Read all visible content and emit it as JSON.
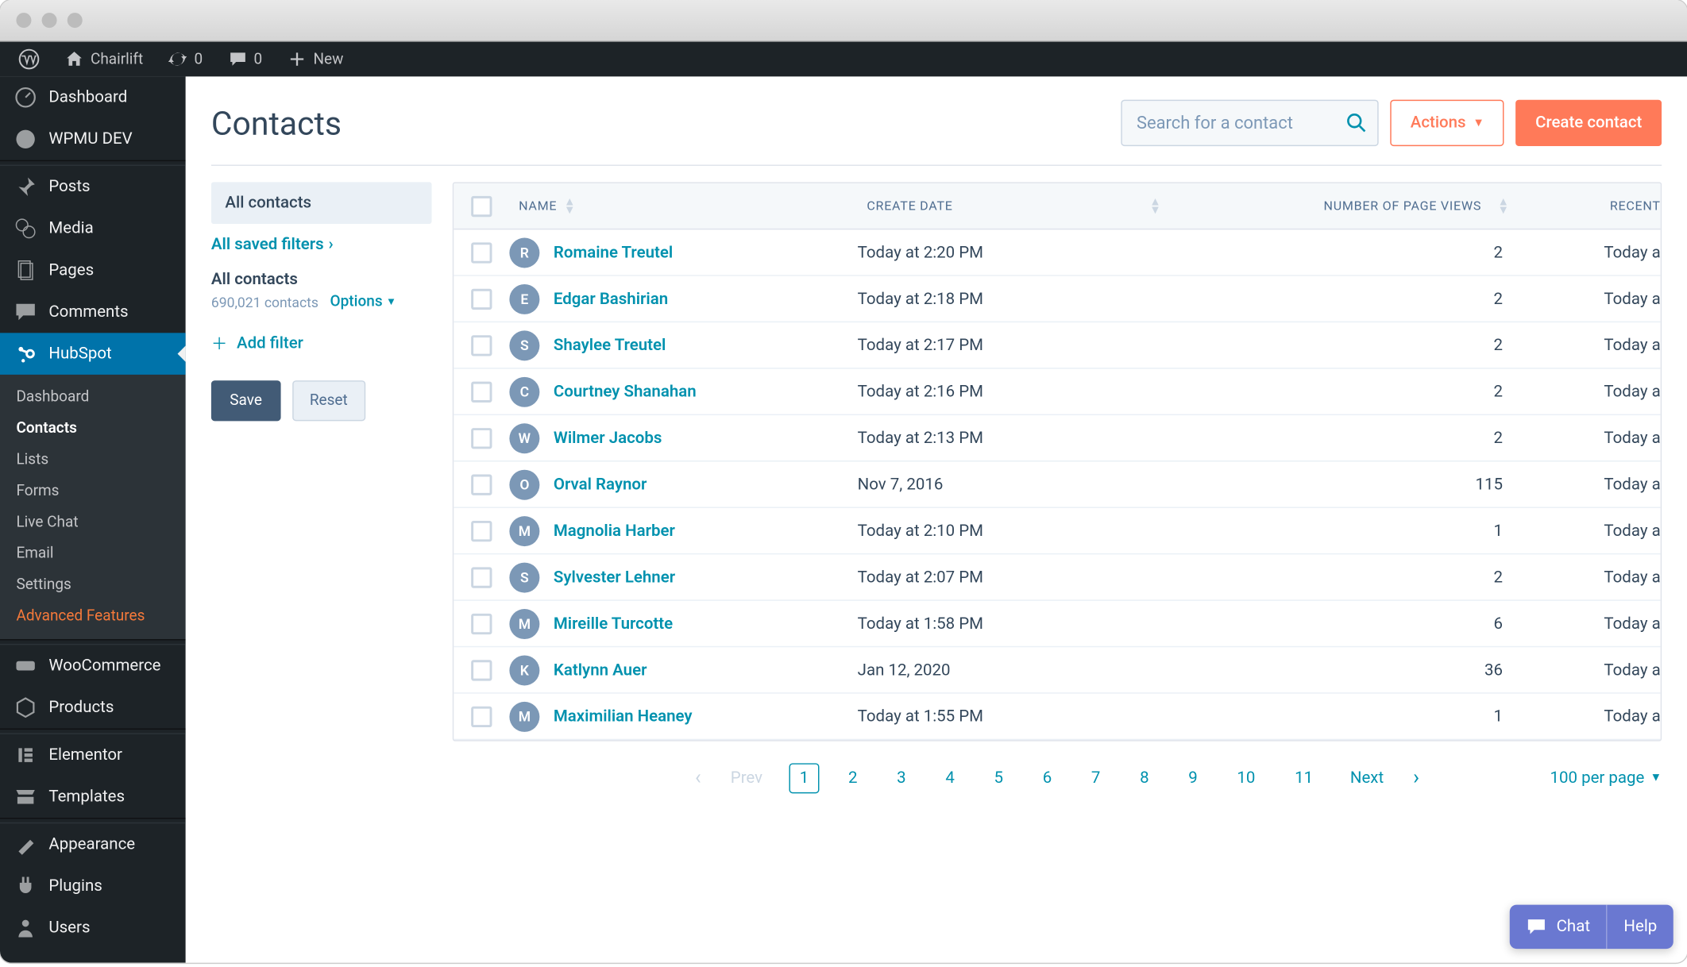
{
  "adminbar": {
    "site_name": "Chairlift",
    "updates_count": "0",
    "comments_count": "0",
    "new_label": "New"
  },
  "wp_menu": {
    "items": [
      {
        "label": "Dashboard",
        "icon": "dashboard"
      },
      {
        "label": "WPMU DEV",
        "icon": "wpmu"
      },
      {
        "label": "Posts",
        "icon": "pin"
      },
      {
        "label": "Media",
        "icon": "media"
      },
      {
        "label": "Pages",
        "icon": "pages"
      },
      {
        "label": "Comments",
        "icon": "comment"
      },
      {
        "label": "HubSpot",
        "icon": "hubspot",
        "active": true
      },
      {
        "label": "WooCommerce",
        "icon": "woo"
      },
      {
        "label": "Products",
        "icon": "products"
      },
      {
        "label": "Elementor",
        "icon": "elementor"
      },
      {
        "label": "Templates",
        "icon": "templates"
      },
      {
        "label": "Appearance",
        "icon": "appearance"
      },
      {
        "label": "Plugins",
        "icon": "plugins"
      },
      {
        "label": "Users",
        "icon": "users"
      }
    ],
    "submenu": [
      {
        "label": "Dashboard"
      },
      {
        "label": "Contacts",
        "current": true
      },
      {
        "label": "Lists"
      },
      {
        "label": "Forms"
      },
      {
        "label": "Live Chat"
      },
      {
        "label": "Email"
      },
      {
        "label": "Settings"
      },
      {
        "label": "Advanced Features",
        "orange": true
      }
    ]
  },
  "page": {
    "title": "Contacts"
  },
  "search": {
    "placeholder": "Search for a contact"
  },
  "buttons": {
    "actions": "Actions",
    "create": "Create contact",
    "save": "Save",
    "reset": "Reset",
    "add_filter": "Add filter"
  },
  "filters": {
    "tab": "All contacts",
    "saved": "All saved filters",
    "heading": "All contacts",
    "count": "690,021 contacts",
    "options": "Options"
  },
  "table": {
    "headers": {
      "name": "NAME",
      "create_date": "CREATE DATE",
      "page_views": "NUMBER OF PAGE VIEWS",
      "recent": "RECENT"
    },
    "rows": [
      {
        "initial": "R",
        "name": "Romaine Treutel",
        "create": "Today at 2:20 PM",
        "views": "2",
        "recent": "Today a"
      },
      {
        "initial": "E",
        "name": "Edgar Bashirian",
        "create": "Today at 2:18 PM",
        "views": "2",
        "recent": "Today a"
      },
      {
        "initial": "S",
        "name": "Shaylee Treutel",
        "create": "Today at 2:17 PM",
        "views": "2",
        "recent": "Today a"
      },
      {
        "initial": "C",
        "name": "Courtney Shanahan",
        "create": "Today at 2:16 PM",
        "views": "2",
        "recent": "Today a"
      },
      {
        "initial": "W",
        "name": "Wilmer Jacobs",
        "create": "Today at 2:13 PM",
        "views": "2",
        "recent": "Today a"
      },
      {
        "initial": "O",
        "name": "Orval Raynor",
        "create": "Nov 7, 2016",
        "views": "115",
        "recent": "Today a"
      },
      {
        "initial": "M",
        "name": "Magnolia Harber",
        "create": "Today at 2:10 PM",
        "views": "1",
        "recent": "Today a"
      },
      {
        "initial": "S",
        "name": "Sylvester Lehner",
        "create": "Today at 2:07 PM",
        "views": "2",
        "recent": "Today a"
      },
      {
        "initial": "M",
        "name": "Mireille Turcotte",
        "create": "Today at 1:58 PM",
        "views": "6",
        "recent": "Today a"
      },
      {
        "initial": "K",
        "name": "Katlynn Auer",
        "create": "Jan 12, 2020",
        "views": "36",
        "recent": "Today a"
      },
      {
        "initial": "M",
        "name": "Maximilian Heaney",
        "create": "Today at 1:55 PM",
        "views": "1",
        "recent": "Today a"
      }
    ]
  },
  "pagination": {
    "prev": "Prev",
    "pages": [
      "1",
      "2",
      "3",
      "4",
      "5",
      "6",
      "7",
      "8",
      "9",
      "10",
      "11"
    ],
    "next": "Next",
    "per_page": "100 per page"
  },
  "chat": {
    "chat": "Chat",
    "help": "Help"
  }
}
